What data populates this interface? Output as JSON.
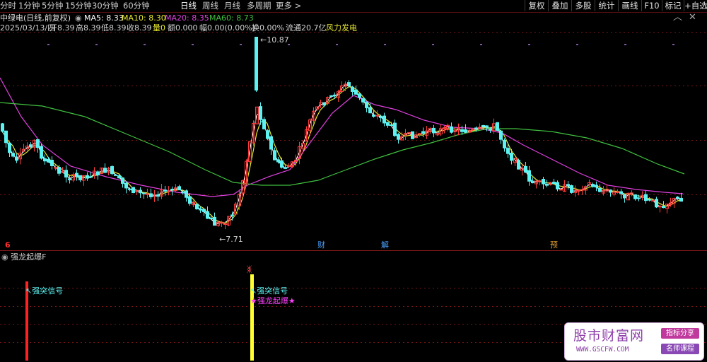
{
  "toolbar": {
    "stock_name": "中绿电(日线,前复权)",
    "timeframes": [
      "分时",
      "1分钟",
      "5分钟",
      "15分钟",
      "30分钟",
      "60分钟",
      "日线",
      "周线",
      "月线",
      "多周期",
      "更多 >"
    ],
    "active_timeframe": "日线",
    "buttons": [
      "复权",
      "叠加",
      "多股",
      "统计",
      "画线",
      "F10",
      "标记",
      "+自选"
    ]
  },
  "ma_legend": {
    "circle_icon": "circle-icon",
    "ma5": "MA5: 8.33",
    "ma10": "MA10: 8.30",
    "ma20": "MA20: 8.35",
    "ma60": "MA60: 8.73"
  },
  "info_bar": {
    "date": "2025/03/13/四",
    "open": "开8.39",
    "high": "高8.39",
    "low": "低8.39",
    "close": "收8.39",
    "volume_label": "量0",
    "amount": "额0.000",
    "change": "幅0.00(0.00%)",
    "turnover": "换0.00%",
    "float_cap": "流通20.7亿",
    "sector": "风力发电"
  },
  "price_labels": {
    "high": "10.87",
    "low": "7.71"
  },
  "event_markers": [
    {
      "label": "6",
      "color": "#ff3030"
    },
    {
      "label": "财",
      "color": "#4aa0ff"
    },
    {
      "label": "解",
      "color": "#4aa0ff"
    },
    {
      "label": "预",
      "color": "#e0a030"
    }
  ],
  "indicator": {
    "title": "强龙起爆F",
    "signal1_label": "强突信号",
    "signal2_label": "强突信号",
    "signal2_sub": "★强龙起爆★"
  },
  "colors": {
    "up": "#ff3c3c",
    "down": "#5cf2f2",
    "ma5": "#ffffff",
    "ma10": "#e8e830",
    "ma20": "#e040e0",
    "ma60": "#40c040",
    "grid": "#7a1414"
  },
  "watermark": {
    "title": "股市财富网",
    "url": "WWW.GSCFW.COM",
    "tag1": "指标分享",
    "tag2": "名师课程"
  }
}
